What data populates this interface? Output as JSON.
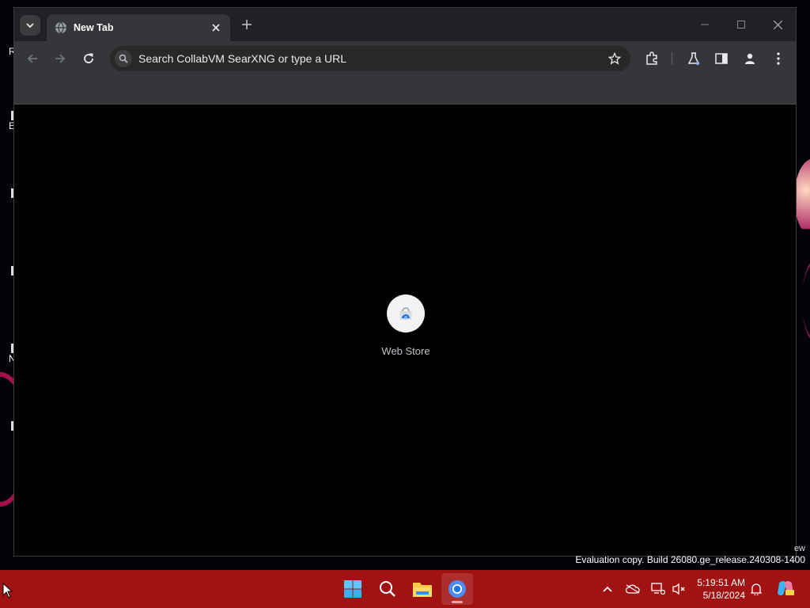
{
  "desktop": {
    "icon_fragments": [
      "R",
      "E",
      "N"
    ]
  },
  "browser": {
    "tab": {
      "title": "New Tab"
    },
    "omnibox": {
      "placeholder": "Search CollabVM SearXNG or type a URL"
    },
    "shortcuts": [
      {
        "label": "Web Store"
      }
    ]
  },
  "watermark": {
    "fragment": "ew",
    "text": "Evaluation copy. Build 26080.ge_release.240308-1400"
  },
  "taskbar": {
    "time": "5:19:51 AM",
    "date": "5/18/2024",
    "colors": {
      "background": "#a11212"
    }
  }
}
